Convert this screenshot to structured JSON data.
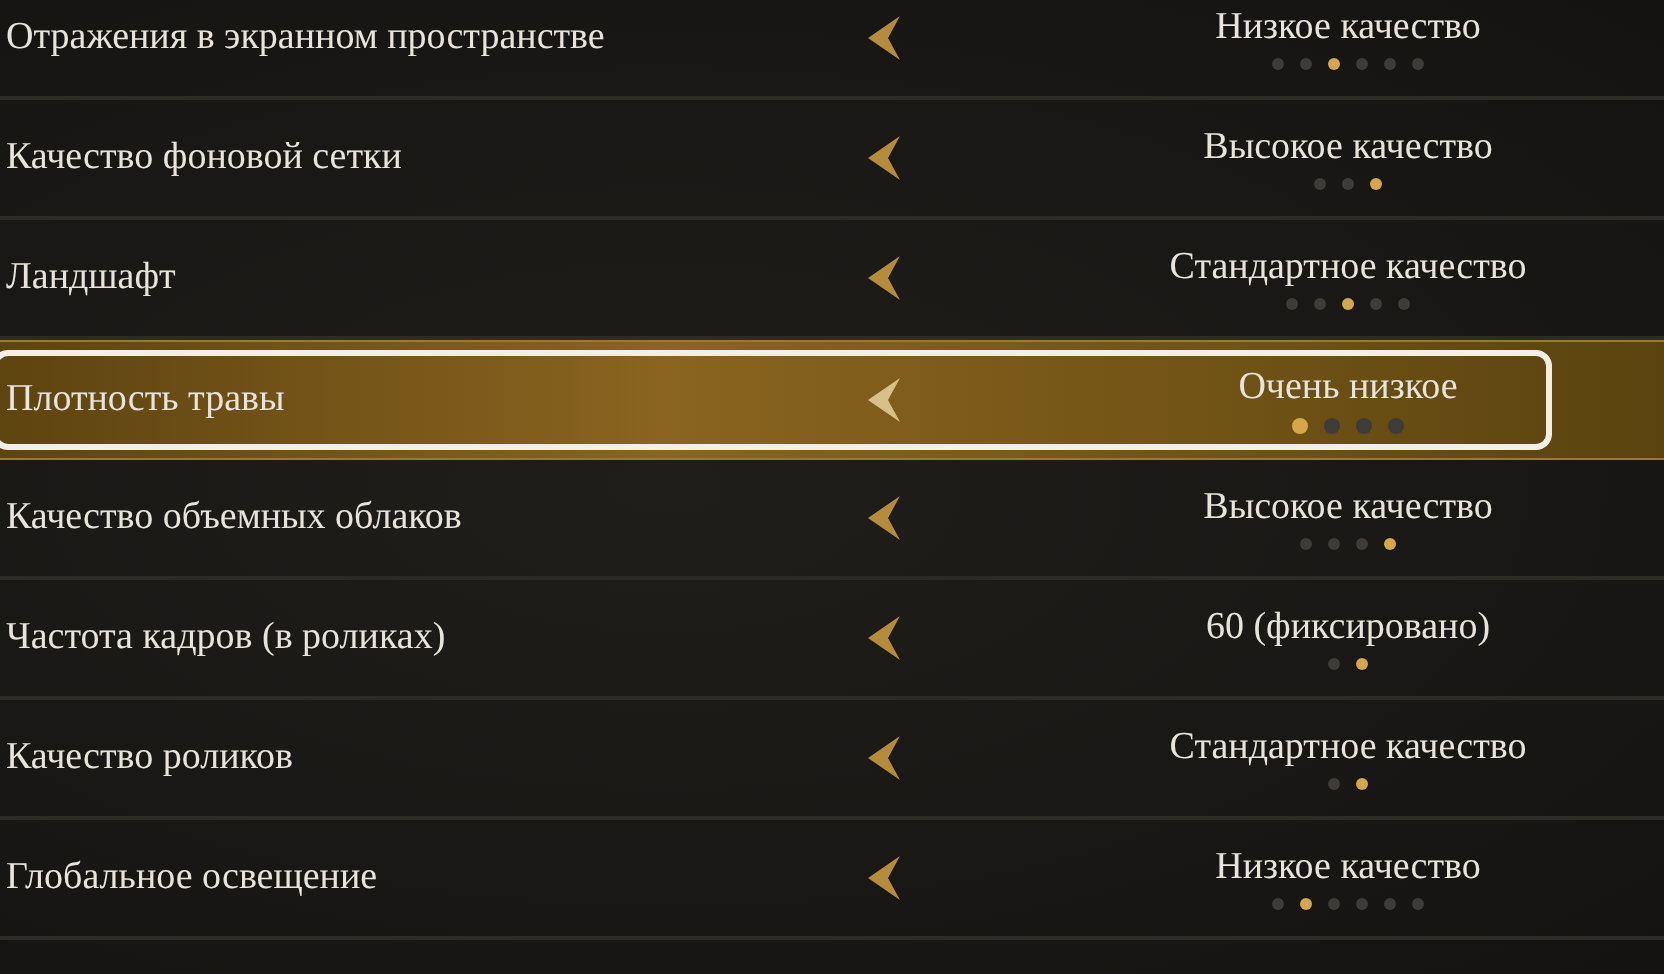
{
  "rows": [
    {
      "label": "Отражения в экранном пространстве",
      "value": "Низкое качество",
      "selected": false,
      "dots": [
        {
          "selected": false
        },
        {
          "selected": false
        },
        {
          "selected": true
        },
        {
          "selected": false
        },
        {
          "selected": false
        },
        {
          "selected": false
        }
      ]
    },
    {
      "label": "Качество фоновой сетки",
      "value": "Высокое качество",
      "selected": false,
      "dots": [
        {
          "selected": false
        },
        {
          "selected": false
        },
        {
          "selected": true
        }
      ]
    },
    {
      "label": "Ландшафт",
      "value": "Стандартное качество",
      "selected": false,
      "dots": [
        {
          "selected": false
        },
        {
          "selected": false
        },
        {
          "selected": true
        },
        {
          "selected": false
        },
        {
          "selected": false
        }
      ]
    },
    {
      "label": "Плотность травы",
      "value": "Очень низкое",
      "selected": true,
      "dots": [
        {
          "selected": true
        },
        {
          "selected": false
        },
        {
          "selected": false
        },
        {
          "selected": false
        }
      ]
    },
    {
      "label": "Качество объемных облаков",
      "value": "Высокое качество",
      "selected": false,
      "dots": [
        {
          "selected": false
        },
        {
          "selected": false
        },
        {
          "selected": false
        },
        {
          "selected": true
        }
      ]
    },
    {
      "label": "Частота кадров (в роликах)",
      "value": "60 (фиксировано)",
      "selected": false,
      "dots": [
        {
          "selected": false
        },
        {
          "selected": true
        }
      ]
    },
    {
      "label": "Качество роликов",
      "value": "Стандартное качество",
      "selected": false,
      "dots": [
        {
          "selected": false
        },
        {
          "selected": true
        }
      ]
    },
    {
      "label": "Глобальное освещение",
      "value": "Низкое качество",
      "selected": false,
      "dots": [
        {
          "selected": false
        },
        {
          "selected": true
        },
        {
          "selected": false
        },
        {
          "selected": false
        },
        {
          "selected": false
        },
        {
          "selected": false
        }
      ]
    }
  ]
}
